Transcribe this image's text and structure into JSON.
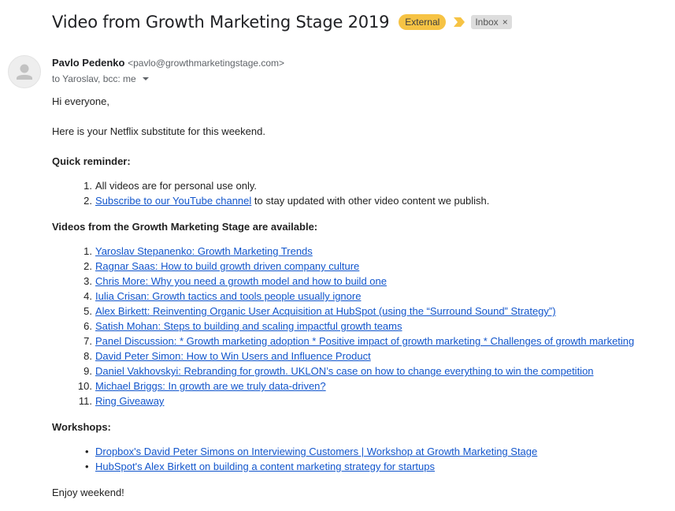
{
  "email": {
    "subject": "Video from Growth Marketing Stage 2019",
    "labels": {
      "external": "External",
      "inbox": "Inbox",
      "inbox_remove": "×"
    },
    "sender": {
      "name": "Pavlo Pedenko",
      "email": "<pavlo@growthmarketingstage.com>"
    },
    "recipients": "to Yaroslav, bcc: me",
    "greeting": "Hi everyone,",
    "intro": "Here is your Netflix substitute for this weekend.",
    "reminder_heading": "Quick reminder:",
    "reminders": [
      {
        "num": "1.",
        "text": "All videos are for personal use only.",
        "link": "",
        "after": ""
      },
      {
        "num": "2.",
        "text": "",
        "link": "Subscribe to our YouTube channel",
        "after": " to stay updated with other video content we publish."
      }
    ],
    "videos_heading": "Videos from the Growth Marketing Stage are available:",
    "videos": [
      {
        "num": "1.",
        "link": "Yaroslav Stepanenko: Growth Marketing Trends"
      },
      {
        "num": "2.",
        "link": "Ragnar Saas: How to build growth driven company culture"
      },
      {
        "num": "3.",
        "link": "Chris More: Why you need a growth model and how to build one"
      },
      {
        "num": "4.",
        "link": "Iulia Crisan: Growth tactics and tools people usually ignore"
      },
      {
        "num": "5.",
        "link": "Alex Birkett: Reinventing Organic User Acquisition at HubSpot (using the “Surround Sound” Strategy”)"
      },
      {
        "num": "6.",
        "link": "Satish Mohan: Steps to building and scaling impactful growth teams"
      },
      {
        "num": "7.",
        "link": "Panel Discussion: * Growth marketing adoption * Positive impact of growth marketing * Challenges of growth marketing"
      },
      {
        "num": "8.",
        "link": "David Peter Simon: How to Win Users and Influence Product"
      },
      {
        "num": "9.",
        "link": "Daniel Vakhovskyi: Rebranding for growth. UKLON’s case on how to change everything to win the competition"
      },
      {
        "num": "10.",
        "link": "Michael Briggs: In growth are we truly data-driven?"
      },
      {
        "num": "11.",
        "link": "Ring Giveaway"
      }
    ],
    "workshops_heading": "Workshops:",
    "workshops": [
      {
        "bullet": "•",
        "link": "Dropbox's David Peter Simons on Interviewing Customers | Workshop at Growth Marketing Stage"
      },
      {
        "bullet": "•",
        "link": "HubSpot's Alex Birkett on building a content marketing strategy for startups"
      }
    ],
    "closing": "Enjoy weekend!"
  },
  "icons": {
    "importance": "importance-marker-icon",
    "avatar": "person-avatar-icon",
    "recipients_dropdown": "chevron-down-icon"
  },
  "colors": {
    "external_badge": "#f6c344",
    "importance": "#f6c344",
    "inbox_badge": "#dddddd",
    "link": "#1155cc"
  }
}
